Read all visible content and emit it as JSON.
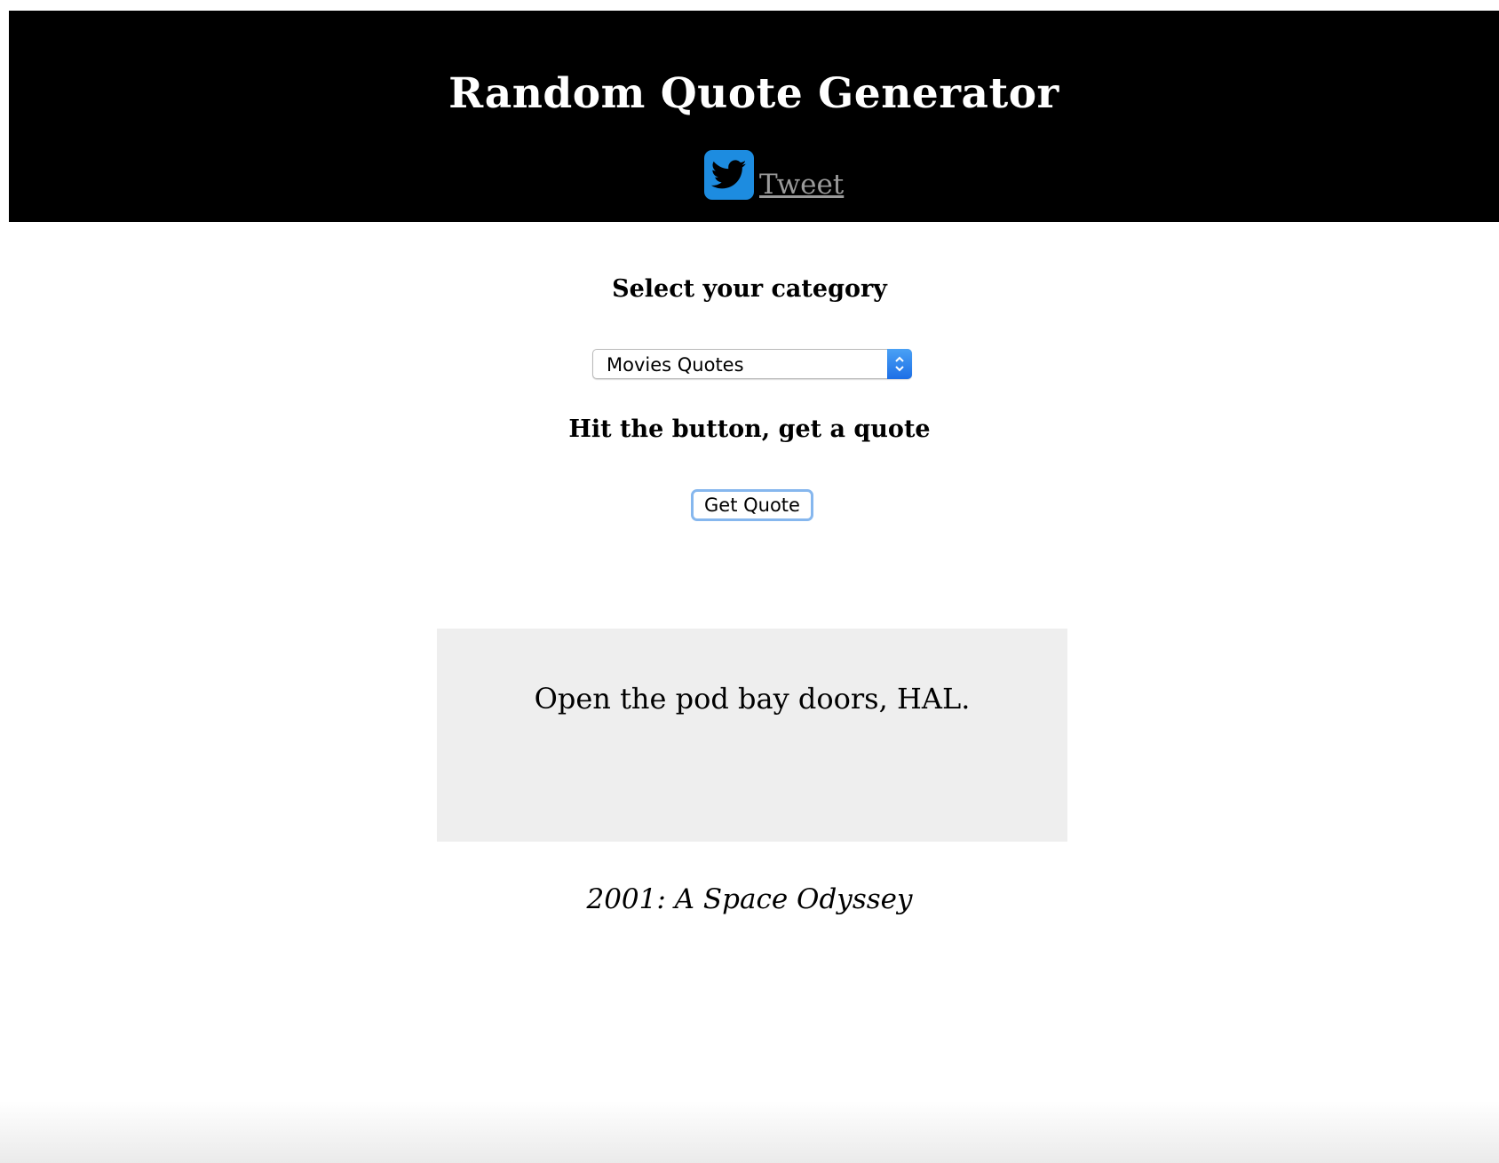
{
  "header": {
    "title": "Random Quote Generator",
    "tweet_label": " Tweet",
    "tweet_icon": "twitter-bird-icon",
    "background_color": "#000000",
    "twitter_color": "#1d8ce0"
  },
  "category": {
    "heading": "Select your category",
    "selected": "Movies Quotes"
  },
  "action": {
    "heading": "Hit the button, get a quote",
    "button_label": "Get Quote"
  },
  "quote": {
    "text": "Open the pod bay doors, HAL.",
    "source": "2001: A Space Odyssey",
    "box_color": "#eeeeee"
  }
}
